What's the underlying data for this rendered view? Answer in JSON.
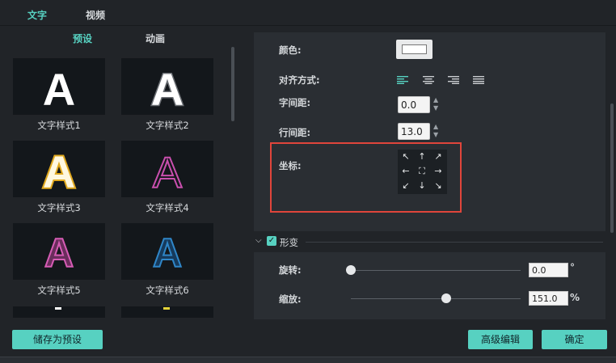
{
  "tabs": {
    "text": "文字",
    "video": "视频"
  },
  "left": {
    "subtabs": {
      "preset": "预设",
      "animation": "动画"
    },
    "styles": [
      {
        "label": "文字样式1"
      },
      {
        "label": "文字样式2"
      },
      {
        "label": "文字样式3"
      },
      {
        "label": "文字样式4"
      },
      {
        "label": "文字样式5"
      },
      {
        "label": "文字样式6"
      }
    ],
    "glyph": "A",
    "save_preset": "储存为预设"
  },
  "props": {
    "color_label": "颜色:",
    "align_label": "对齐方式:",
    "spacing_label": "字间距:",
    "spacing_value": "0.0",
    "line_label": "行间距:",
    "line_value": "13.0",
    "coord_label": "坐标:"
  },
  "transform": {
    "title": "形变",
    "rotate_label": "旋转:",
    "rotate_value": "0.0",
    "rotate_unit": "°",
    "rotate_level": 0,
    "scale_label": "缩放:",
    "scale_value": "151.0",
    "scale_unit": "%",
    "scale_level": 0.56
  },
  "buttons": {
    "advanced": "高级编辑",
    "ok": "确定"
  },
  "colors": {
    "accent": "#57d1c1",
    "highlight": "#e0453b"
  }
}
